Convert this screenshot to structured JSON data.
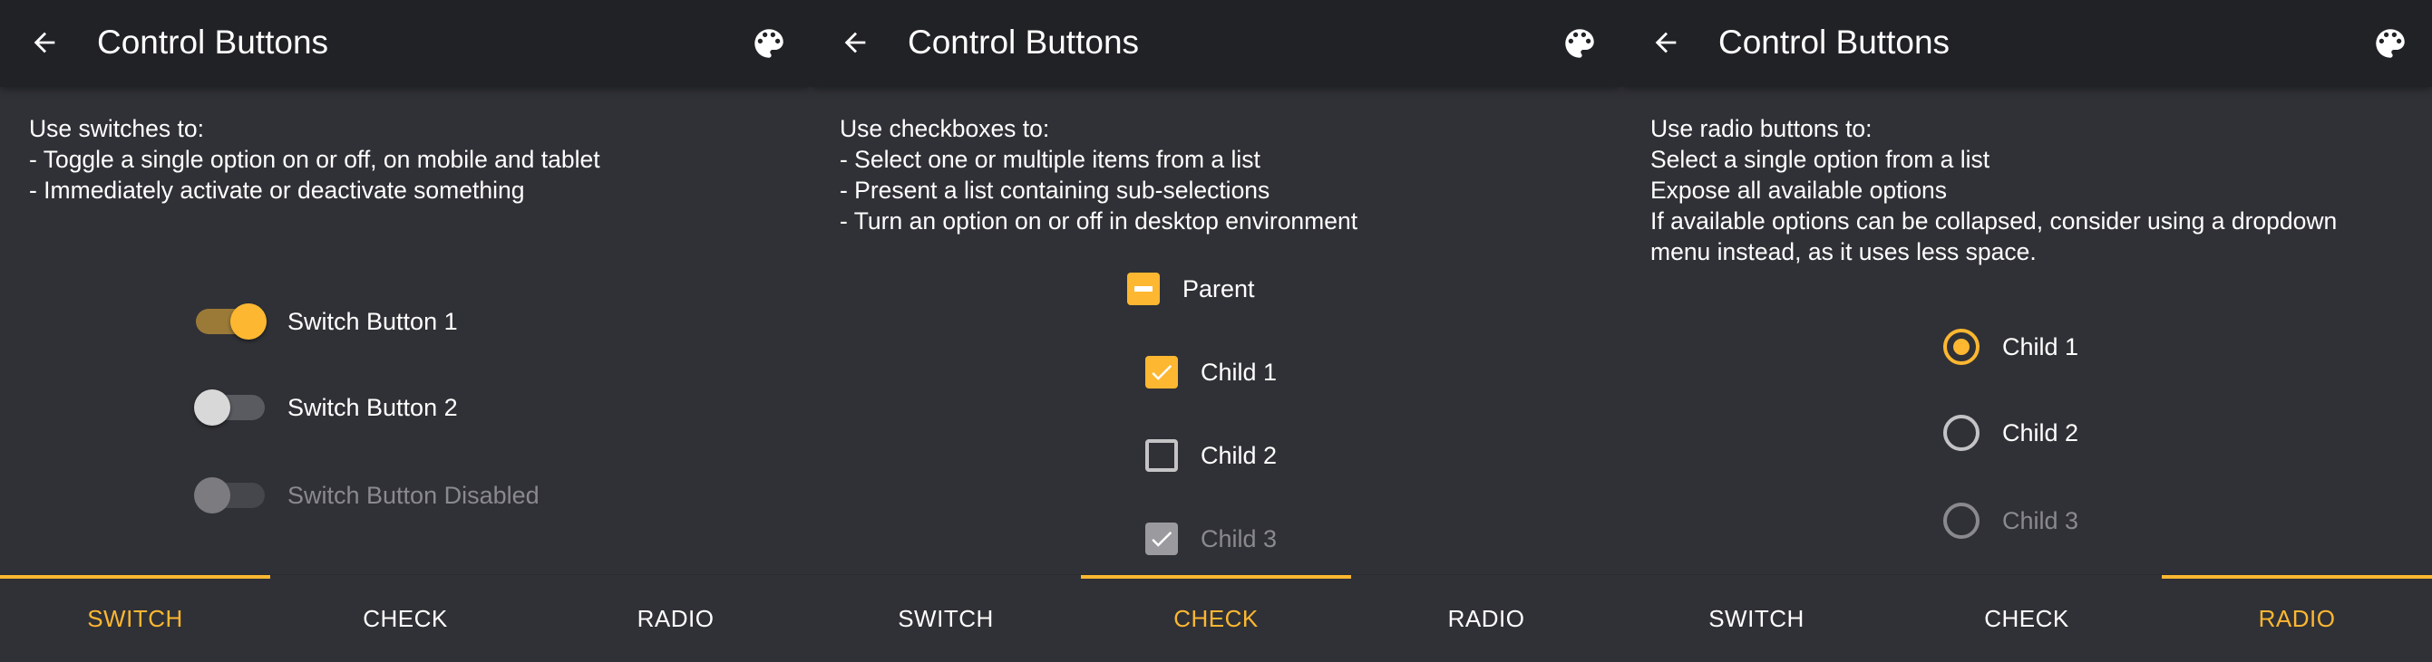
{
  "accent_color": "#fdb731",
  "app_bar": {
    "back_icon": "arrow-left-icon",
    "title": "Control Buttons",
    "palette_icon": "palette-icon"
  },
  "tabs": [
    "SWITCH",
    "CHECK",
    "RADIO"
  ],
  "panels": {
    "switch": {
      "active_tab": "SWITCH",
      "description": [
        "Use switches to:",
        "- Toggle a single option on or off, on mobile and tablet",
        "- Immediately activate or deactivate something"
      ],
      "items": [
        {
          "label": "Switch Button 1",
          "state": "on",
          "enabled": true
        },
        {
          "label": "Switch Button 2",
          "state": "off",
          "enabled": true
        },
        {
          "label": "Switch Button Disabled",
          "state": "off",
          "enabled": false
        }
      ]
    },
    "check": {
      "active_tab": "CHECK",
      "description": [
        "Use checkboxes to:",
        "- Select one or multiple items from a list",
        "- Present a list containing sub-selections",
        "- Turn an option on or off in desktop environment"
      ],
      "parent": {
        "label": "Parent",
        "state": "indeterminate"
      },
      "children": [
        {
          "label": "Child 1",
          "state": "checked",
          "enabled": true
        },
        {
          "label": "Child 2",
          "state": "unchecked",
          "enabled": true
        },
        {
          "label": "Child 3",
          "state": "checked",
          "enabled": false
        }
      ]
    },
    "radio": {
      "active_tab": "RADIO",
      "description": [
        "Use radio buttons to:",
        "Select a single option from a list",
        "Expose all available options",
        "If available options can be collapsed, consider using a dropdown",
        "menu instead, as it uses less space."
      ],
      "items": [
        {
          "label": "Child 1",
          "selected": true,
          "enabled": true
        },
        {
          "label": "Child 2",
          "selected": false,
          "enabled": true
        },
        {
          "label": "Child 3",
          "selected": false,
          "enabled": false
        }
      ]
    }
  }
}
